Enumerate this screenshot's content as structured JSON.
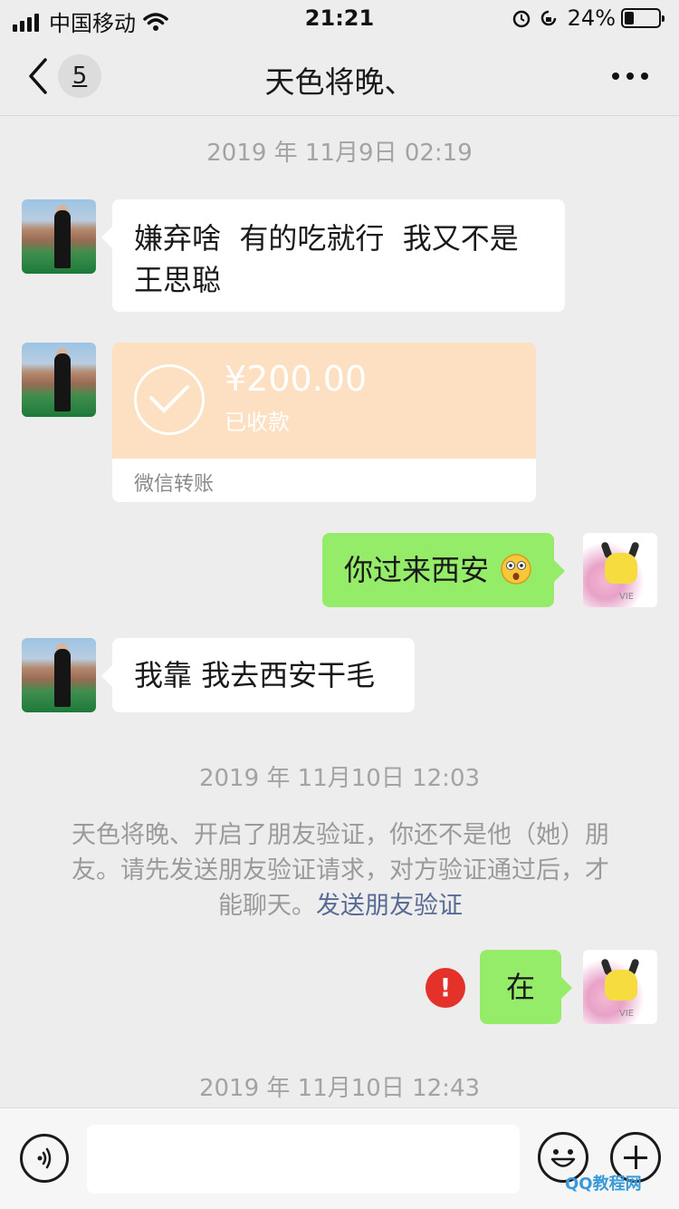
{
  "status_bar": {
    "carrier": "中国移动",
    "time": "21:21",
    "battery": "24%"
  },
  "header": {
    "unread_count": "5",
    "title": "天色将晚、"
  },
  "messages": [
    {
      "timestamp": "2019 年 11月9日 02:19"
    },
    {
      "text_line1": "嫌弃啥  有的吃就行  我又不是",
      "text_line2": "王思聪"
    },
    {
      "amount": "¥200.00",
      "status": "已收款",
      "label": "微信转账"
    },
    {
      "text": "你过来西安"
    },
    {
      "text": "我靠 我去西安干毛"
    },
    {
      "timestamp": "2019 年 11月10日 12:03"
    },
    {
      "line1": "天色将晚、开启了朋友验证，你还不是他（她）朋",
      "line2": "友。请先发送朋友验证请求，对方验证通过后，才",
      "line3_text": "能聊天。",
      "link": "发送朋友验证"
    },
    {
      "text": "在",
      "error": "!"
    },
    {
      "timestamp": "2019 年 11月10日 12:43"
    }
  ],
  "self_avatar_tag": "VIE",
  "watermark": "QQ教程网",
  "colors": {
    "incoming_bubble": "#ffffff",
    "outgoing_bubble": "#95ec69",
    "transfer": "#fde0c2",
    "link": "#576b95",
    "error": "#e4322b"
  }
}
